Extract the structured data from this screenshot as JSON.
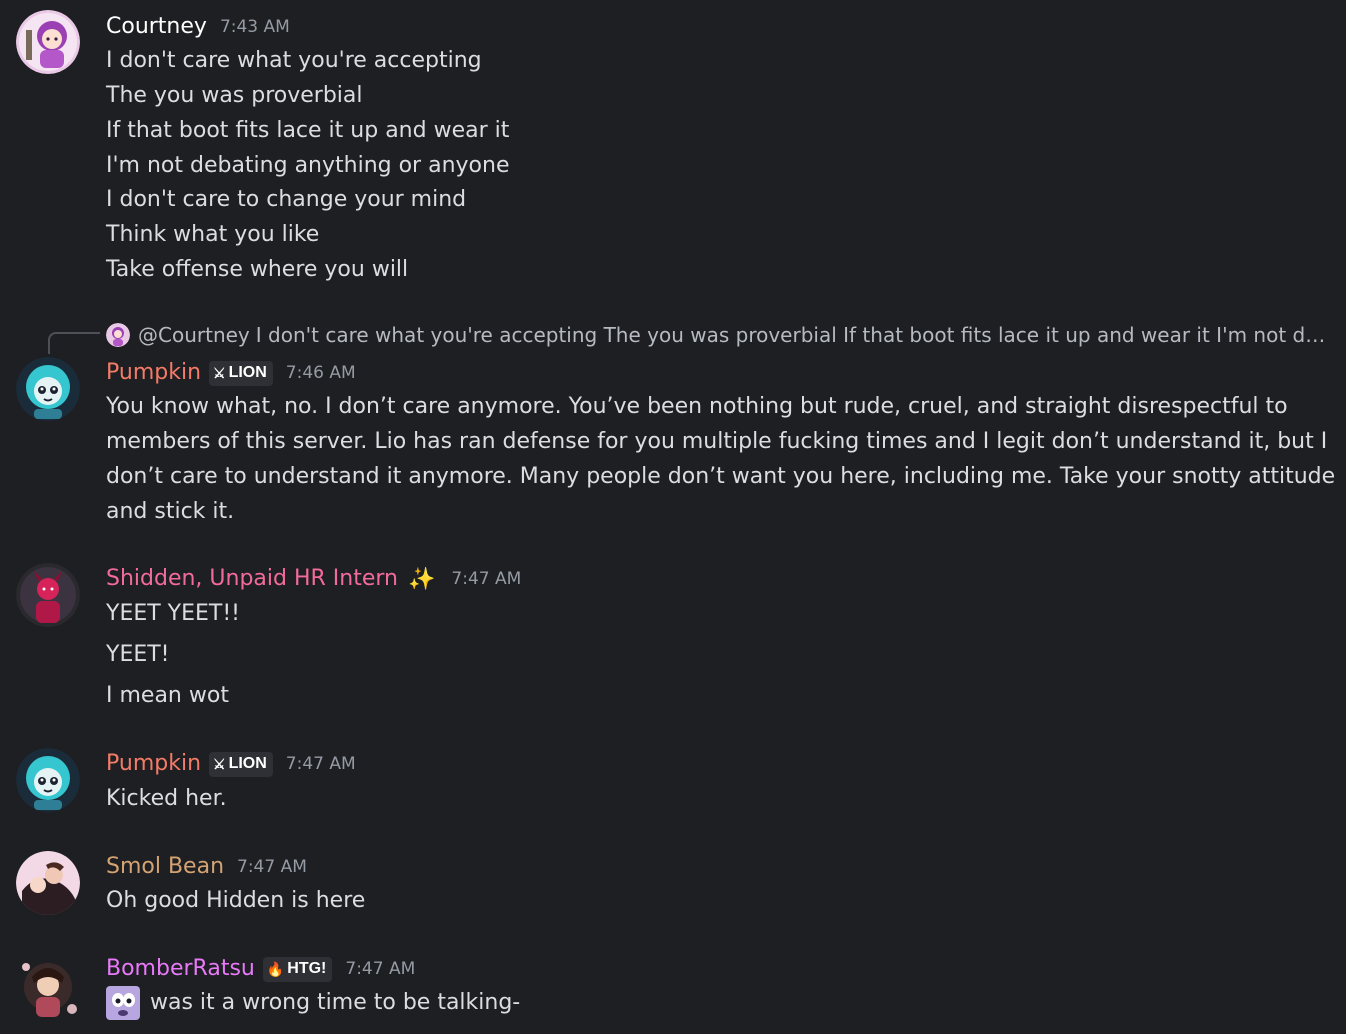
{
  "colors": {
    "background": "#1e1f22",
    "message_text": "#dbdee1",
    "timestamp": "#949ba4",
    "courtney": "#ffffff",
    "pumpkin": "#f47b67",
    "shidden": "#f26b9a",
    "smolbean": "#d4a373",
    "bomberratsu": "#e879f9"
  },
  "messages": [
    {
      "author": "Courtney",
      "time": "7:43 AM",
      "lines": [
        "I don't care what you're accepting",
        "The you was proverbial",
        "If that boot fits lace it up and wear it",
        "I'm not debating anything or anyone",
        "I don't care to change your mind",
        "Think what you like",
        "Take offense where you will"
      ]
    },
    {
      "reply": {
        "author": "@Courtney",
        "text": "I don't care what you're accepting  The you was proverbial  If that boot fits lace it up and wear it I'm not debating a..."
      },
      "author": "Pumpkin",
      "badge": {
        "icon": "sword-icon",
        "label": "LION"
      },
      "time": "7:46 AM",
      "text": "You know what, no. I don’t care anymore. You’ve been nothing but rude, cruel, and straight disrespectful to members of this server. Lio has ran defense for you multiple fucking times and I legit don’t understand it, but I don’t care to understand it anymore. Many people don’t want you here, including me. Take your snotty attitude and stick it."
    },
    {
      "author": "Shidden, Unpaid HR Intern",
      "author_emoji": "✨",
      "time": "7:47 AM",
      "lines": [
        "YEET YEET!!",
        "YEET!",
        "I mean wot"
      ]
    },
    {
      "author": "Pumpkin",
      "badge": {
        "icon": "sword-icon",
        "label": "LION"
      },
      "time": "7:47 AM",
      "lines": [
        "Kicked her."
      ]
    },
    {
      "author": "Smol Bean",
      "time": "7:47 AM",
      "lines": [
        "Oh good Hidden is here"
      ]
    },
    {
      "author": "BomberRatsu",
      "badge": {
        "icon": "flame-icon",
        "label": "HTG!"
      },
      "time": "7:47 AM",
      "emoji": "shocked-ghost-emoji",
      "lines": [
        "was it a wrong time to be talking-"
      ]
    }
  ]
}
